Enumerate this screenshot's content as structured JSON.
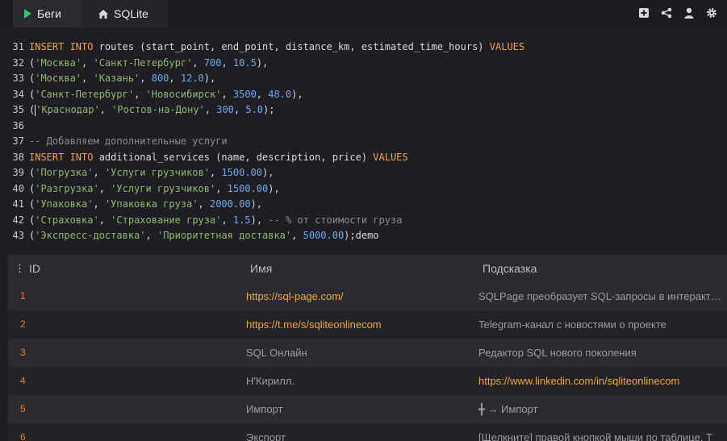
{
  "tabs": {
    "run_label": "Беги",
    "sqlite_label": "SQLite"
  },
  "toolbar": {
    "icons": [
      "add-icon",
      "share-icon",
      "user-icon",
      "gear-icon"
    ]
  },
  "editor": {
    "lines": [
      {
        "n": "31",
        "tokens": [
          [
            "kw",
            "INSERT INTO"
          ],
          [
            "pl",
            " routes (start_point, end_point, distance_km, estimated_time_hours) "
          ],
          [
            "kw",
            "VALUES"
          ]
        ]
      },
      {
        "n": "32",
        "tokens": [
          [
            "pl",
            "("
          ],
          [
            "str",
            "'Москва'"
          ],
          [
            "pl",
            ", "
          ],
          [
            "str",
            "'Санкт-Петербург'"
          ],
          [
            "pl",
            ", "
          ],
          [
            "num",
            "700"
          ],
          [
            "pl",
            ", "
          ],
          [
            "num",
            "10.5"
          ],
          [
            "pl",
            "),"
          ]
        ]
      },
      {
        "n": "33",
        "tokens": [
          [
            "pl",
            "("
          ],
          [
            "str",
            "'Москва'"
          ],
          [
            "pl",
            ", "
          ],
          [
            "str",
            "'Казань'"
          ],
          [
            "pl",
            ", "
          ],
          [
            "num",
            "800"
          ],
          [
            "pl",
            ", "
          ],
          [
            "num",
            "12.0"
          ],
          [
            "pl",
            "),"
          ]
        ]
      },
      {
        "n": "34",
        "tokens": [
          [
            "pl",
            "("
          ],
          [
            "str",
            "'Санкт-Петербург'"
          ],
          [
            "pl",
            ", "
          ],
          [
            "str",
            "'Новосибирск'"
          ],
          [
            "pl",
            ", "
          ],
          [
            "num",
            "3500"
          ],
          [
            "pl",
            ", "
          ],
          [
            "num",
            "48.0"
          ],
          [
            "pl",
            "),"
          ]
        ]
      },
      {
        "n": "35",
        "tokens": [
          [
            "pl",
            "("
          ],
          [
            "cursor",
            ""
          ],
          [
            "str",
            "'Краснодар'"
          ],
          [
            "pl",
            ", "
          ],
          [
            "str",
            "'Ростов-на-Дону'"
          ],
          [
            "pl",
            ", "
          ],
          [
            "num",
            "300"
          ],
          [
            "pl",
            ", "
          ],
          [
            "num",
            "5.0"
          ],
          [
            "pl",
            ");"
          ]
        ]
      },
      {
        "n": "36",
        "tokens": []
      },
      {
        "n": "37",
        "tokens": [
          [
            "cm",
            "-- Добавляем дополнительные услуги"
          ]
        ]
      },
      {
        "n": "38",
        "tokens": [
          [
            "kw",
            "INSERT INTO"
          ],
          [
            "pl",
            " additional_services (name, description, price) "
          ],
          [
            "kw",
            "VALUES"
          ]
        ]
      },
      {
        "n": "39",
        "tokens": [
          [
            "pl",
            "("
          ],
          [
            "str",
            "'Погрузка'"
          ],
          [
            "pl",
            ", "
          ],
          [
            "str",
            "'Услуги грузчиков'"
          ],
          [
            "pl",
            ", "
          ],
          [
            "num",
            "1500.00"
          ],
          [
            "pl",
            "),"
          ]
        ]
      },
      {
        "n": "40",
        "tokens": [
          [
            "pl",
            "("
          ],
          [
            "str",
            "'Разгрузка'"
          ],
          [
            "pl",
            ", "
          ],
          [
            "str",
            "'Услуги грузчиков'"
          ],
          [
            "pl",
            ", "
          ],
          [
            "num",
            "1500.00"
          ],
          [
            "pl",
            "),"
          ]
        ]
      },
      {
        "n": "41",
        "tokens": [
          [
            "pl",
            "("
          ],
          [
            "str",
            "'Упаковка'"
          ],
          [
            "pl",
            ", "
          ],
          [
            "str",
            "'Упаковка груза'"
          ],
          [
            "pl",
            ", "
          ],
          [
            "num",
            "2000.00"
          ],
          [
            "pl",
            "),"
          ]
        ]
      },
      {
        "n": "42",
        "tokens": [
          [
            "pl",
            "("
          ],
          [
            "str",
            "'Страховка'"
          ],
          [
            "pl",
            ", "
          ],
          [
            "str",
            "'Страхование груза'"
          ],
          [
            "pl",
            ", "
          ],
          [
            "num",
            "1.5"
          ],
          [
            "pl",
            "), "
          ],
          [
            "cm",
            "-- % от стоимости груза"
          ]
        ]
      },
      {
        "n": "43",
        "tokens": [
          [
            "pl",
            "("
          ],
          [
            "str",
            "'Экспресс-доставка'"
          ],
          [
            "pl",
            ", "
          ],
          [
            "str",
            "'Приоритетная доставка'"
          ],
          [
            "pl",
            ", "
          ],
          [
            "num",
            "5000.00"
          ],
          [
            "pl",
            ");demo"
          ]
        ]
      }
    ]
  },
  "table": {
    "headers": {
      "id": "ID",
      "name": "Имя",
      "hint": "Подсказка"
    },
    "rows": [
      {
        "id": "1",
        "name": "https://sql-page.com/",
        "name_link": true,
        "hint": "SQLPage преобразует SQL-запросы в интерактивные веб-сайты",
        "hint_link": false
      },
      {
        "id": "2",
        "name": "https://t.me/s/sqliteonlinecom",
        "name_link": true,
        "hint": "Telegram-канал с новостями о проекте",
        "hint_link": false
      },
      {
        "id": "3",
        "name": "SQL Онлайн",
        "name_link": false,
        "hint": "Редактор SQL нового поколения",
        "hint_link": false
      },
      {
        "id": "4",
        "name": "Н'Кирилл.",
        "name_link": false,
        "hint": "https://www.linkedin.com/in/sqliteonlinecom",
        "hint_link": true
      },
      {
        "id": "5",
        "name": "Импорт",
        "name_link": false,
        "hint": "╋ → Импорт",
        "hint_link": false
      },
      {
        "id": "6",
        "name": "Экспорт",
        "name_link": false,
        "hint": "[Щелкните] правой кнопкой мыши по таблице, Т",
        "hint_link": false
      }
    ]
  }
}
